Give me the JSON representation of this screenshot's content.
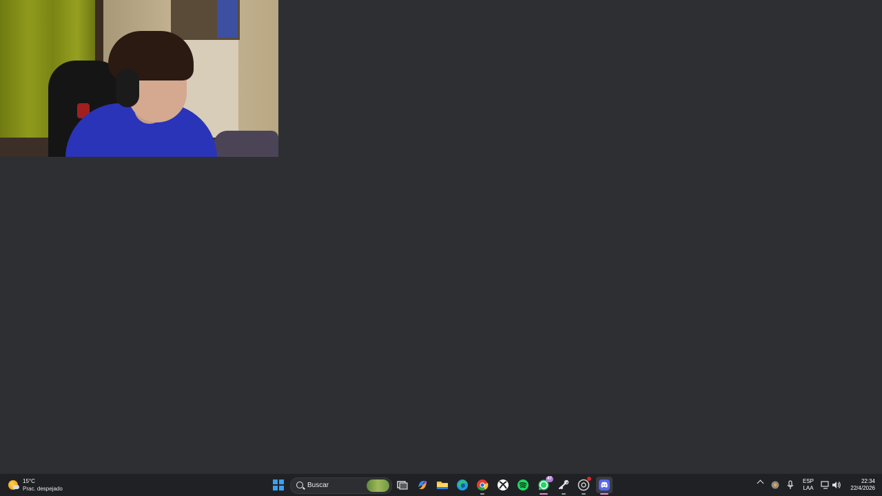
{
  "webcam": {
    "description": ""
  },
  "taskbar": {
    "weather": {
      "temperature": "15°C",
      "condition": "Prac. despejado"
    },
    "search": {
      "placeholder": "Buscar"
    },
    "pinned_apps": [
      {
        "name": "Task View",
        "icon": "task-view-icon"
      },
      {
        "name": "Copilot",
        "icon": "copilot-icon"
      },
      {
        "name": "File Explorer",
        "icon": "folder-icon"
      },
      {
        "name": "Microsoft Edge",
        "icon": "edge-icon"
      },
      {
        "name": "Google Chrome",
        "icon": "chrome-icon"
      },
      {
        "name": "Xbox",
        "icon": "xbox-icon"
      },
      {
        "name": "Spotify",
        "icon": "spotify-icon"
      },
      {
        "name": "WhatsApp",
        "icon": "whatsapp-icon",
        "badge": "47"
      },
      {
        "name": "Steam",
        "icon": "steam-icon"
      },
      {
        "name": "OBS",
        "icon": "recording-app-icon"
      },
      {
        "name": "Discord",
        "icon": "discord-icon"
      }
    ],
    "tray": {
      "language_line1": "ESP",
      "language_line2": "LAA",
      "time": "22:34",
      "date": "22/4/2026"
    },
    "colors": {
      "taskbar_bg": "#202124",
      "desktop_bg": "#2e2f32",
      "accent": "#3aa0f2"
    }
  }
}
